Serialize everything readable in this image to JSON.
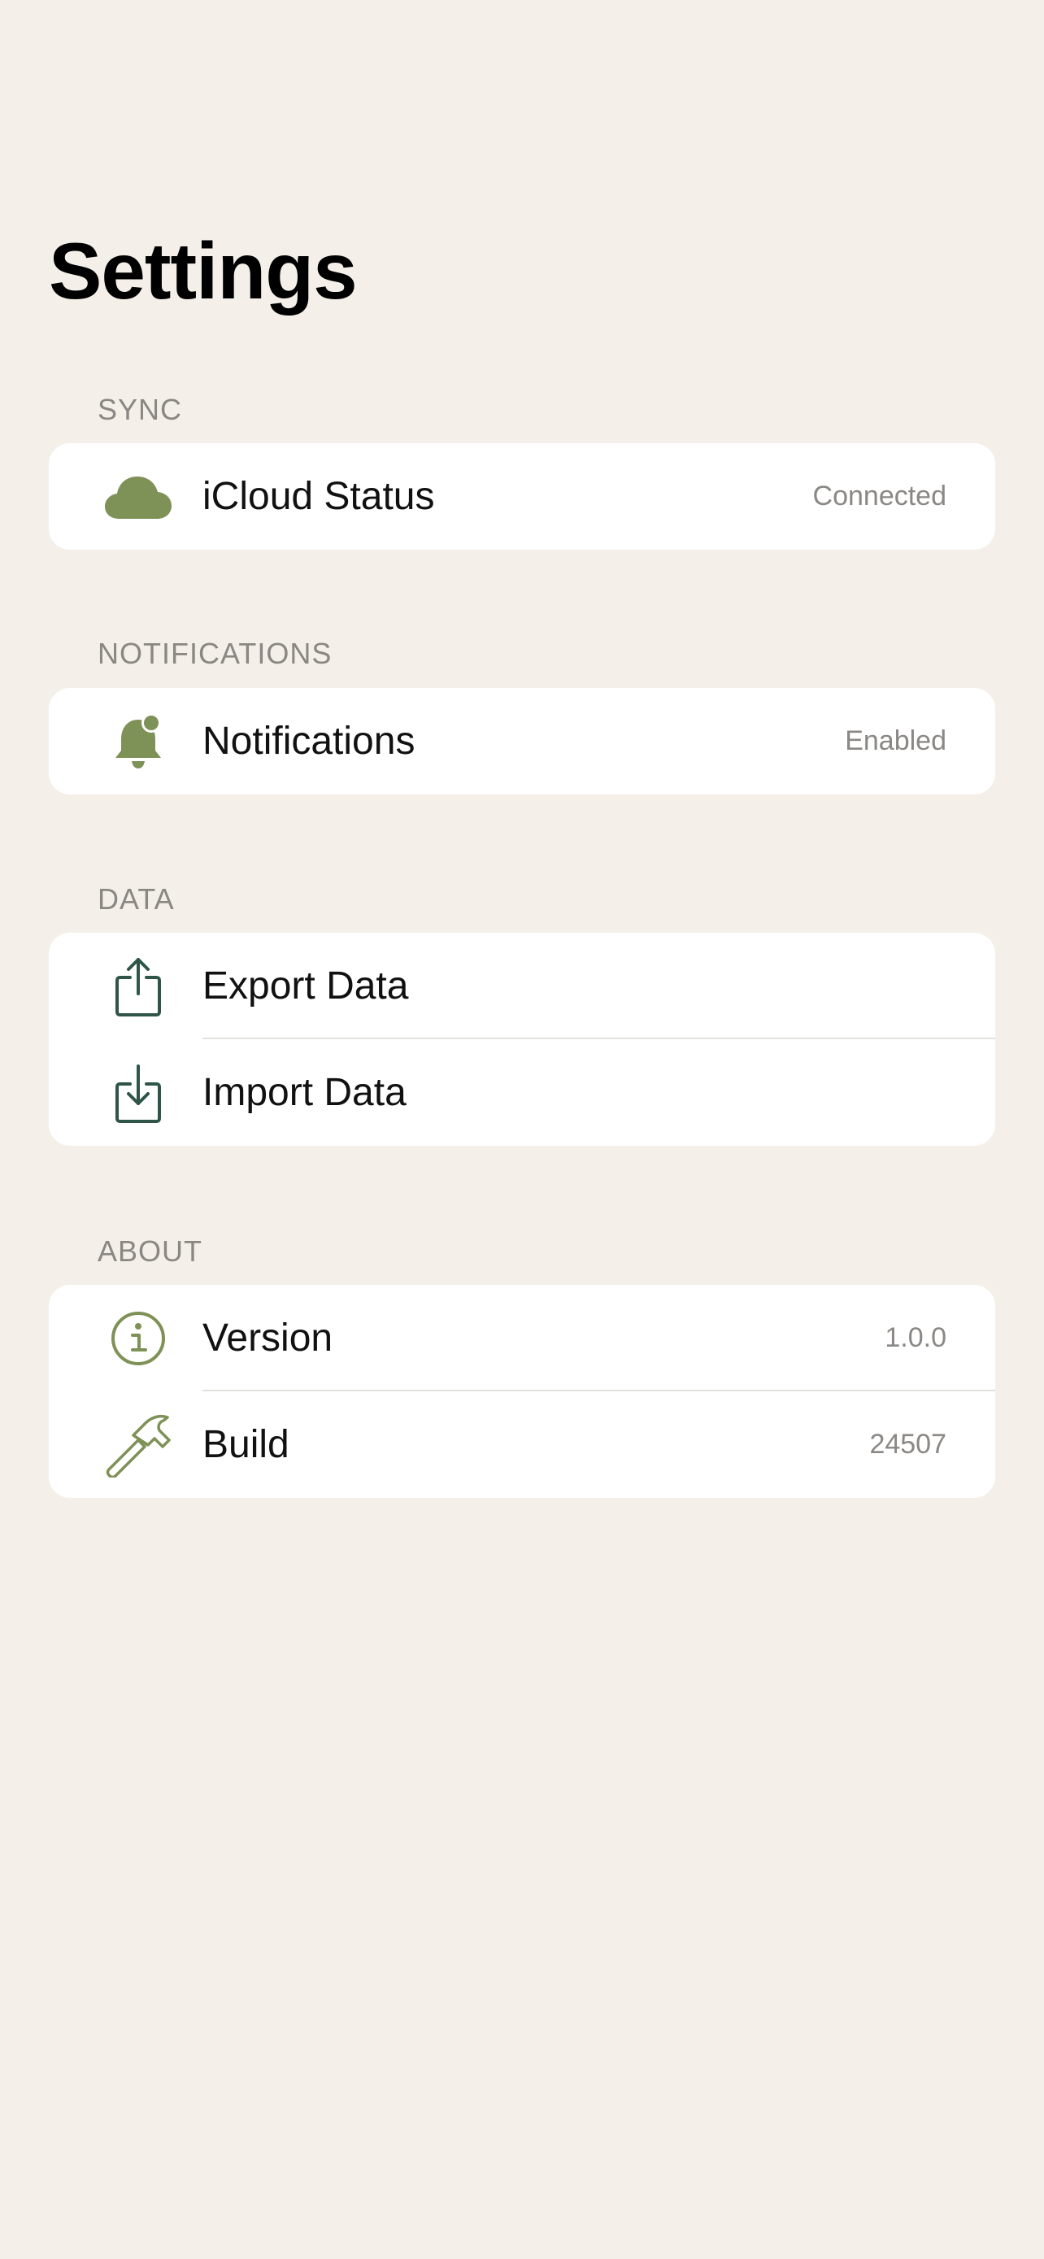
{
  "title": "Settings",
  "colors": {
    "background": "#F4F0E9",
    "accent_green": "#7E9157",
    "dark_teal": "#2F5548",
    "secondary_text": "#8A8784"
  },
  "sections": {
    "sync": {
      "header": "SYNC",
      "rows": [
        {
          "icon": "cloud-icon",
          "label": "iCloud Status",
          "value": "Connected"
        }
      ]
    },
    "notifications": {
      "header": "NOTIFICATIONS",
      "rows": [
        {
          "icon": "bell-badge-icon",
          "label": "Notifications",
          "value": "Enabled"
        }
      ]
    },
    "data": {
      "header": "DATA",
      "rows": [
        {
          "icon": "share-upload-icon",
          "label": "Export Data"
        },
        {
          "icon": "download-tray-icon",
          "label": "Import Data"
        }
      ]
    },
    "about": {
      "header": "ABOUT",
      "rows": [
        {
          "icon": "info-circle-icon",
          "label": "Version",
          "value": "1.0.0"
        },
        {
          "icon": "hammer-icon",
          "label": "Build",
          "value": "24507"
        }
      ]
    }
  }
}
